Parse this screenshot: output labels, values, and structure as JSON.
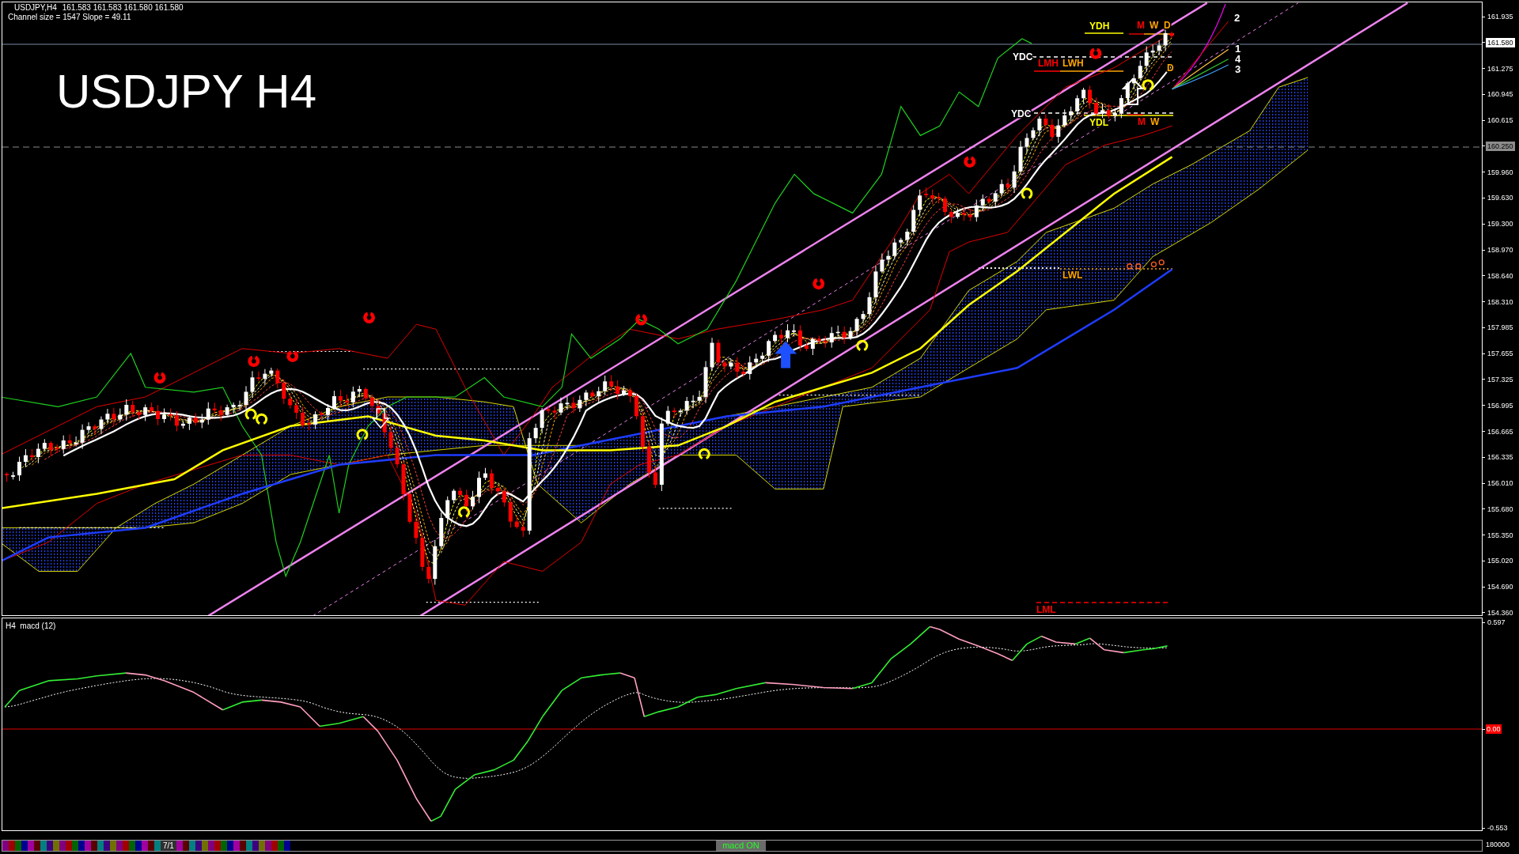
{
  "header": {
    "symbol": "USDJPY,H4",
    "ohlc": "161.583 161.583 161.580 161.580",
    "channel_info": "Channel size = 1547 Slope = 49.11"
  },
  "title_overlay": "USDJPY H4",
  "price_axis": [
    {
      "label": "161.935",
      "kind": "tick"
    },
    {
      "label": "161.580",
      "kind": "bid"
    },
    {
      "label": "161.275",
      "kind": "tick"
    },
    {
      "label": "160.945",
      "kind": "tick"
    },
    {
      "label": "160.615",
      "kind": "tick"
    },
    {
      "label": "160.250",
      "kind": "level"
    },
    {
      "label": "159.960",
      "kind": "tick"
    },
    {
      "label": "159.630",
      "kind": "tick"
    },
    {
      "label": "159.300",
      "kind": "tick"
    },
    {
      "label": "158.970",
      "kind": "tick"
    },
    {
      "label": "158.640",
      "kind": "tick"
    },
    {
      "label": "158.310",
      "kind": "tick"
    },
    {
      "label": "157.985",
      "kind": "tick"
    },
    {
      "label": "157.655",
      "kind": "tick"
    },
    {
      "label": "157.325",
      "kind": "tick"
    },
    {
      "label": "156.995",
      "kind": "tick"
    },
    {
      "label": "156.665",
      "kind": "tick"
    },
    {
      "label": "156.335",
      "kind": "tick"
    },
    {
      "label": "156.010",
      "kind": "tick"
    },
    {
      "label": "155.680",
      "kind": "tick"
    },
    {
      "label": "155.350",
      "kind": "tick"
    },
    {
      "label": "155.020",
      "kind": "tick"
    },
    {
      "label": "154.690",
      "kind": "tick"
    },
    {
      "label": "154.360",
      "kind": "tick"
    }
  ],
  "chart_labels": [
    {
      "text": "YDH",
      "color": "#ffff00"
    },
    {
      "text": "M",
      "color": "#ff0000"
    },
    {
      "text": "W",
      "color": "#ffa500"
    },
    {
      "text": "D",
      "color": "#ffa500"
    },
    {
      "text": "YDC",
      "color": "#ffffff"
    },
    {
      "text": "LMH",
      "color": "#ff0000"
    },
    {
      "text": "LWH",
      "color": "#ffa500"
    },
    {
      "text": "D",
      "color": "#ffa500"
    },
    {
      "text": "YDC",
      "color": "#ffffff"
    },
    {
      "text": "YDL",
      "color": "#ffff00"
    },
    {
      "text": "M",
      "color": "#ff0000"
    },
    {
      "text": "W",
      "color": "#ffa500"
    },
    {
      "text": "2",
      "color": "#ffffff"
    },
    {
      "text": "1",
      "color": "#ffffff"
    },
    {
      "text": "4",
      "color": "#ffffff"
    },
    {
      "text": "3",
      "color": "#ffffff"
    },
    {
      "text": "LWL",
      "color": "#ffa500"
    },
    {
      "text": "LML",
      "color": "#ff0000"
    }
  ],
  "macd": {
    "title": "H4  macd (12)",
    "axis": [
      {
        "label": "0.597",
        "kind": "tick"
      },
      {
        "label": "0.00",
        "kind": "zero"
      },
      {
        "label": "-0.553",
        "kind": "tick"
      }
    ]
  },
  "status_strip": {
    "page_label": "7/1",
    "status_text": "macd ON",
    "volume_label": "180000"
  }
}
